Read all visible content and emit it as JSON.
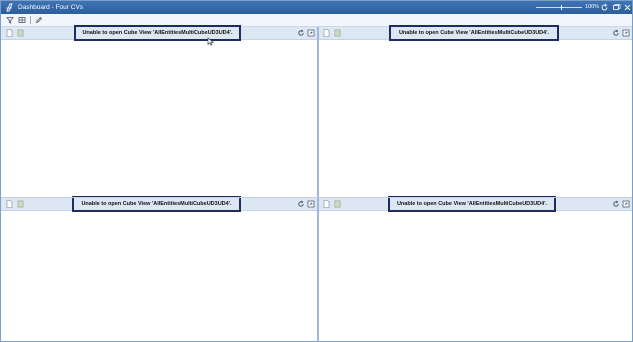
{
  "window": {
    "title": "Dashboard - Four CVs",
    "zoom": "100%",
    "zoom_level": 0.55,
    "accent_color": "#2c5d9c"
  },
  "toolbar": {
    "icons": [
      "filter-icon",
      "grid-icon",
      "pencil-icon"
    ]
  },
  "panels": [
    {
      "id": "top-left",
      "message": "Unable to open Cube View 'AllEntitiesMultiCubeUD3UD4'."
    },
    {
      "id": "top-right",
      "message": "Unable to open Cube View 'AllEntitiesMultiCubeUD3UD4'."
    },
    {
      "id": "bottom-left",
      "message": "Unable to open Cube View 'AllEntitiesMultiCubeUD3UD4'."
    },
    {
      "id": "bottom-right",
      "message": "Unable to open Cube View 'AllEntitiesMultiCubeUD3UD4'."
    }
  ],
  "colors": {
    "panel_header": "#dde7f3",
    "message_border": "#1f2d5c",
    "divider": "#9cb8dc"
  }
}
